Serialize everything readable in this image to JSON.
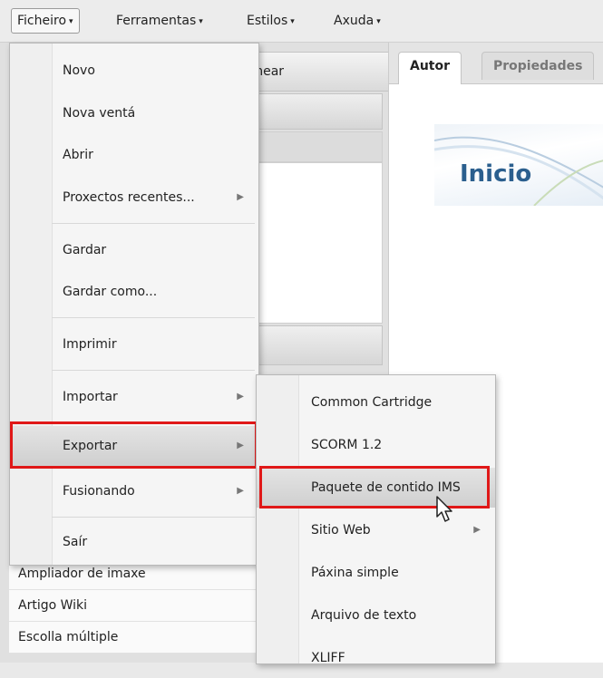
{
  "menubar": {
    "items": [
      {
        "label": "Ficheiro",
        "active": true
      },
      {
        "label": "Ferramentas",
        "active": false
      },
      {
        "label": "Estilos",
        "active": false
      },
      {
        "label": "Axuda",
        "active": false
      }
    ],
    "caret": "▾"
  },
  "left_panel": {
    "rename_label": "nomear",
    "idevices": [
      "Ampliador de imaxe",
      "Artigo Wiki",
      "Escolla múltiple"
    ]
  },
  "right_panel": {
    "tabs": [
      {
        "label": "Autor",
        "active": true
      },
      {
        "label": "Propiedades",
        "active": false
      }
    ],
    "banner_title": "Inicio"
  },
  "file_menu": {
    "items": [
      {
        "label": "Novo",
        "submenu": false
      },
      {
        "label": "Nova ventá",
        "submenu": false
      },
      {
        "label": "Abrir",
        "submenu": false
      },
      {
        "label": "Proxectos recentes...",
        "submenu": true
      },
      {
        "label": "Gardar",
        "submenu": false
      },
      {
        "label": "Gardar como...",
        "submenu": false
      },
      {
        "label": "Imprimir",
        "submenu": false
      },
      {
        "label": "Importar",
        "submenu": true
      },
      {
        "label": "Exportar",
        "submenu": true,
        "highlighted": true
      },
      {
        "label": "Fusionando",
        "submenu": true
      },
      {
        "label": "Saír",
        "submenu": false
      }
    ],
    "submenu_arrow": "▶"
  },
  "export_submenu": {
    "items": [
      {
        "label": "Common Cartridge",
        "submenu": false
      },
      {
        "label": "SCORM 1.2",
        "submenu": false
      },
      {
        "label": "Paquete de contido IMS",
        "submenu": false,
        "highlighted": true
      },
      {
        "label": "Sitio Web",
        "submenu": true
      },
      {
        "label": "Páxina simple",
        "submenu": false
      },
      {
        "label": "Arquivo de texto",
        "submenu": false
      },
      {
        "label": "XLIFF",
        "submenu": false
      }
    ]
  },
  "colors": {
    "highlight_border": "#e01818",
    "banner_title": "#2b5f8e"
  },
  "icons": {
    "cursor": "mouse-pointer-icon"
  }
}
